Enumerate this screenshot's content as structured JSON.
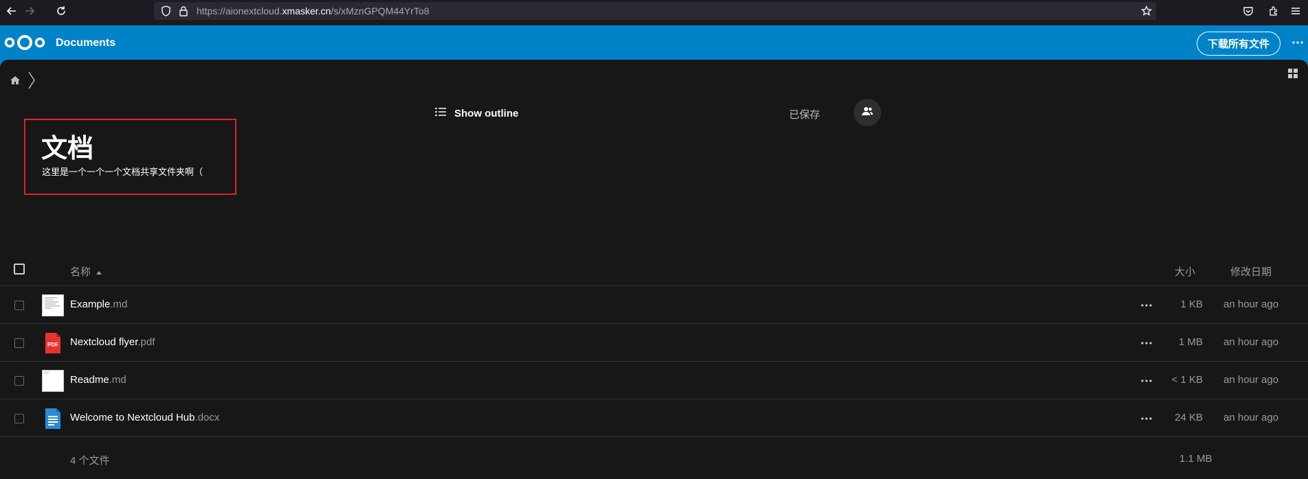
{
  "browser": {
    "url_prefix": "https://aionextcloud.",
    "url_domain": "xmasker.cn",
    "url_path": "/s/xMznGPQM44YrTo8"
  },
  "header": {
    "app_name": "Documents",
    "download_all_label": "下载所有文件",
    "brand_color": "#0082c9"
  },
  "toolbar": {
    "show_outline_label": "Show outline",
    "saved_status": "已保存"
  },
  "readme": {
    "title": "文档",
    "description": "这里是一个一个一个文档共享文件夹啊（"
  },
  "table": {
    "columns": {
      "name": "名称",
      "size": "大小",
      "modified": "修改日期"
    },
    "rows": [
      {
        "base": "Example",
        "ext": ".md",
        "size": "1 KB",
        "modified": "an hour ago",
        "icon": "text-thumbnail-icon"
      },
      {
        "base": "Nextcloud flyer",
        "ext": ".pdf",
        "size": "1 MB",
        "modified": "an hour ago",
        "icon": "pdf-icon"
      },
      {
        "base": "Readme",
        "ext": ".md",
        "size": "< 1 KB",
        "modified": "an hour ago",
        "icon": "blank-thumbnail-icon"
      },
      {
        "base": "Welcome to Nextcloud Hub",
        "ext": ".docx",
        "size": "24 KB",
        "modified": "an hour ago",
        "icon": "document-icon"
      }
    ],
    "summary": {
      "count": "4 个文件",
      "total_size": "1.1 MB"
    }
  },
  "icons": {
    "pdf_badge": "PDF"
  }
}
